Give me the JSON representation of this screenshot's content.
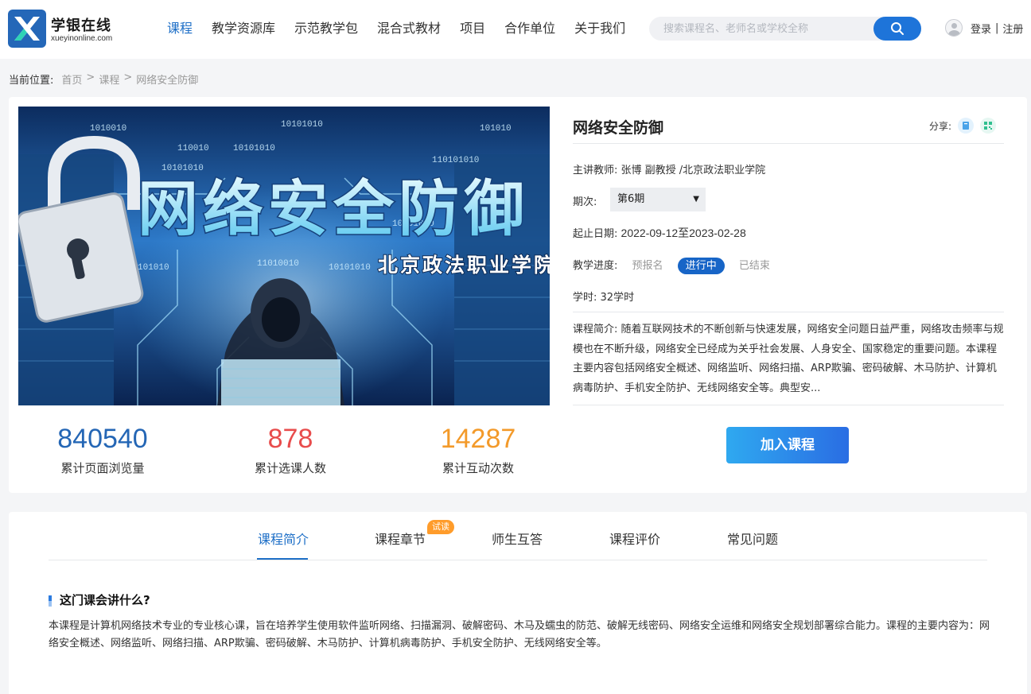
{
  "header": {
    "brand_name": "学银在线",
    "brand_domain": "xueyinonline.com",
    "nav": [
      {
        "label": "课程",
        "active": true
      },
      {
        "label": "教学资源库"
      },
      {
        "label": "示范教学包"
      },
      {
        "label": "混合式教材"
      },
      {
        "label": "项目"
      },
      {
        "label": "合作单位"
      },
      {
        "label": "关于我们"
      }
    ],
    "search": {
      "placeholder": "搜索课程名、老师名或学校全称"
    },
    "login": "登录",
    "divider": "|",
    "register": "注册"
  },
  "breadcrumb": {
    "label": "当前位置:",
    "items": [
      "首页",
      "课程",
      "网络安全防御"
    ],
    "arrow": ">"
  },
  "banner": {
    "title": "网络安全防御",
    "subtitle": "北京政法职业学院",
    "binary_text": [
      "1010010",
      "110010",
      "10101010",
      "10101010",
      "11010010",
      "10101010",
      "101010",
      "10101010",
      "110101010",
      "101010",
      "10101010",
      "10101010"
    ]
  },
  "stats": [
    {
      "value": "840540",
      "label": "累计页面浏览量",
      "color": "#2466b5"
    },
    {
      "value": "878",
      "label": "累计选课人数",
      "color": "#e84c4c"
    },
    {
      "value": "14287",
      "label": "累计互动次数",
      "color": "#f39a2a"
    }
  ],
  "course": {
    "title": "网络安全防御",
    "share_label": "分享:",
    "teacher_label": "主讲教师:",
    "teacher": "张博 副教授 /北京政法职业学院",
    "period_label": "期次:",
    "period": "第6期",
    "dates_label": "起止日期:",
    "dates": "2022-09-12至2023-02-28",
    "progress_label": "教学进度:",
    "progress_steps": [
      "预报名",
      "进行中",
      "已结束"
    ],
    "hours_label": "学时:",
    "hours": "32学时",
    "intro_label": "课程简介:",
    "intro": "随着互联网技术的不断创新与快速发展，网络安全问题日益严重，网络攻击频率与规模也在不断升级，网络安全已经成为关乎社会发展、人身安全、国家稳定的重要问题。本课程主要内容包括网络安全概述、网络监听、网络扫描、ARP欺骗、密码破解、木马防护、计算机病毒防护、手机安全防护、无线网络安全等。典型安...",
    "join_label": "加入课程"
  },
  "tabs": {
    "items": [
      "课程简介",
      "课程章节",
      "师生互答",
      "课程评价",
      "常见问题"
    ],
    "badge": "试读"
  },
  "section": {
    "title": "这门课会讲什么?",
    "text": "本课程是计算机网络技术专业的专业核心课，旨在培养学生使用软件监听网络、扫描漏洞、破解密码、木马及蠕虫的防范、破解无线密码、网络安全运维和网络安全规划部署综合能力。课程的主要内容为：网络安全概述、网络监听、网络扫描、ARP欺骗、密码破解、木马防护、计算机病毒防护、手机安全防护、无线网络安全等。"
  }
}
